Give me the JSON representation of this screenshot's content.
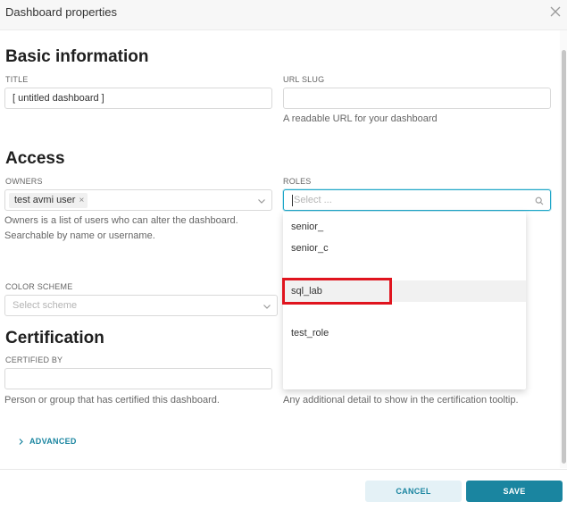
{
  "modal": {
    "title": "Dashboard properties"
  },
  "basic": {
    "heading": "Basic information",
    "title_label": "TITLE",
    "title_value": "[ untitled dashboard ]",
    "slug_label": "URL SLUG",
    "slug_value": "",
    "slug_helper": "A readable URL for your dashboard"
  },
  "access": {
    "heading": "Access",
    "owners_label": "OWNERS",
    "owner_tag": "test avmi user",
    "owners_helper_1": "Owners is a list of users who can alter the dashboard.",
    "owners_helper_2": "Searchable by name or username.",
    "roles_label": "ROLES",
    "roles_placeholder": "Select ..."
  },
  "color_scheme": {
    "label": "COLOR SCHEME",
    "placeholder": "Select scheme"
  },
  "certification": {
    "heading": "Certification",
    "certified_by_label": "CERTIFIED BY",
    "certified_by_value": "",
    "certified_by_helper": "Person or group that has certified this dashboard.",
    "details_helper": "Any additional detail to show in the certification tooltip."
  },
  "roles_dropdown": {
    "options": [
      "senior_",
      "senior_c",
      "sql_lab",
      "test_role"
    ],
    "active": "sql_lab"
  },
  "advanced": {
    "label": "ADVANCED"
  },
  "footer": {
    "cancel_label": "CANCEL",
    "save_label": "SAVE"
  },
  "colors": {
    "accent": "#1a85a0",
    "highlight": "#e0141e"
  }
}
